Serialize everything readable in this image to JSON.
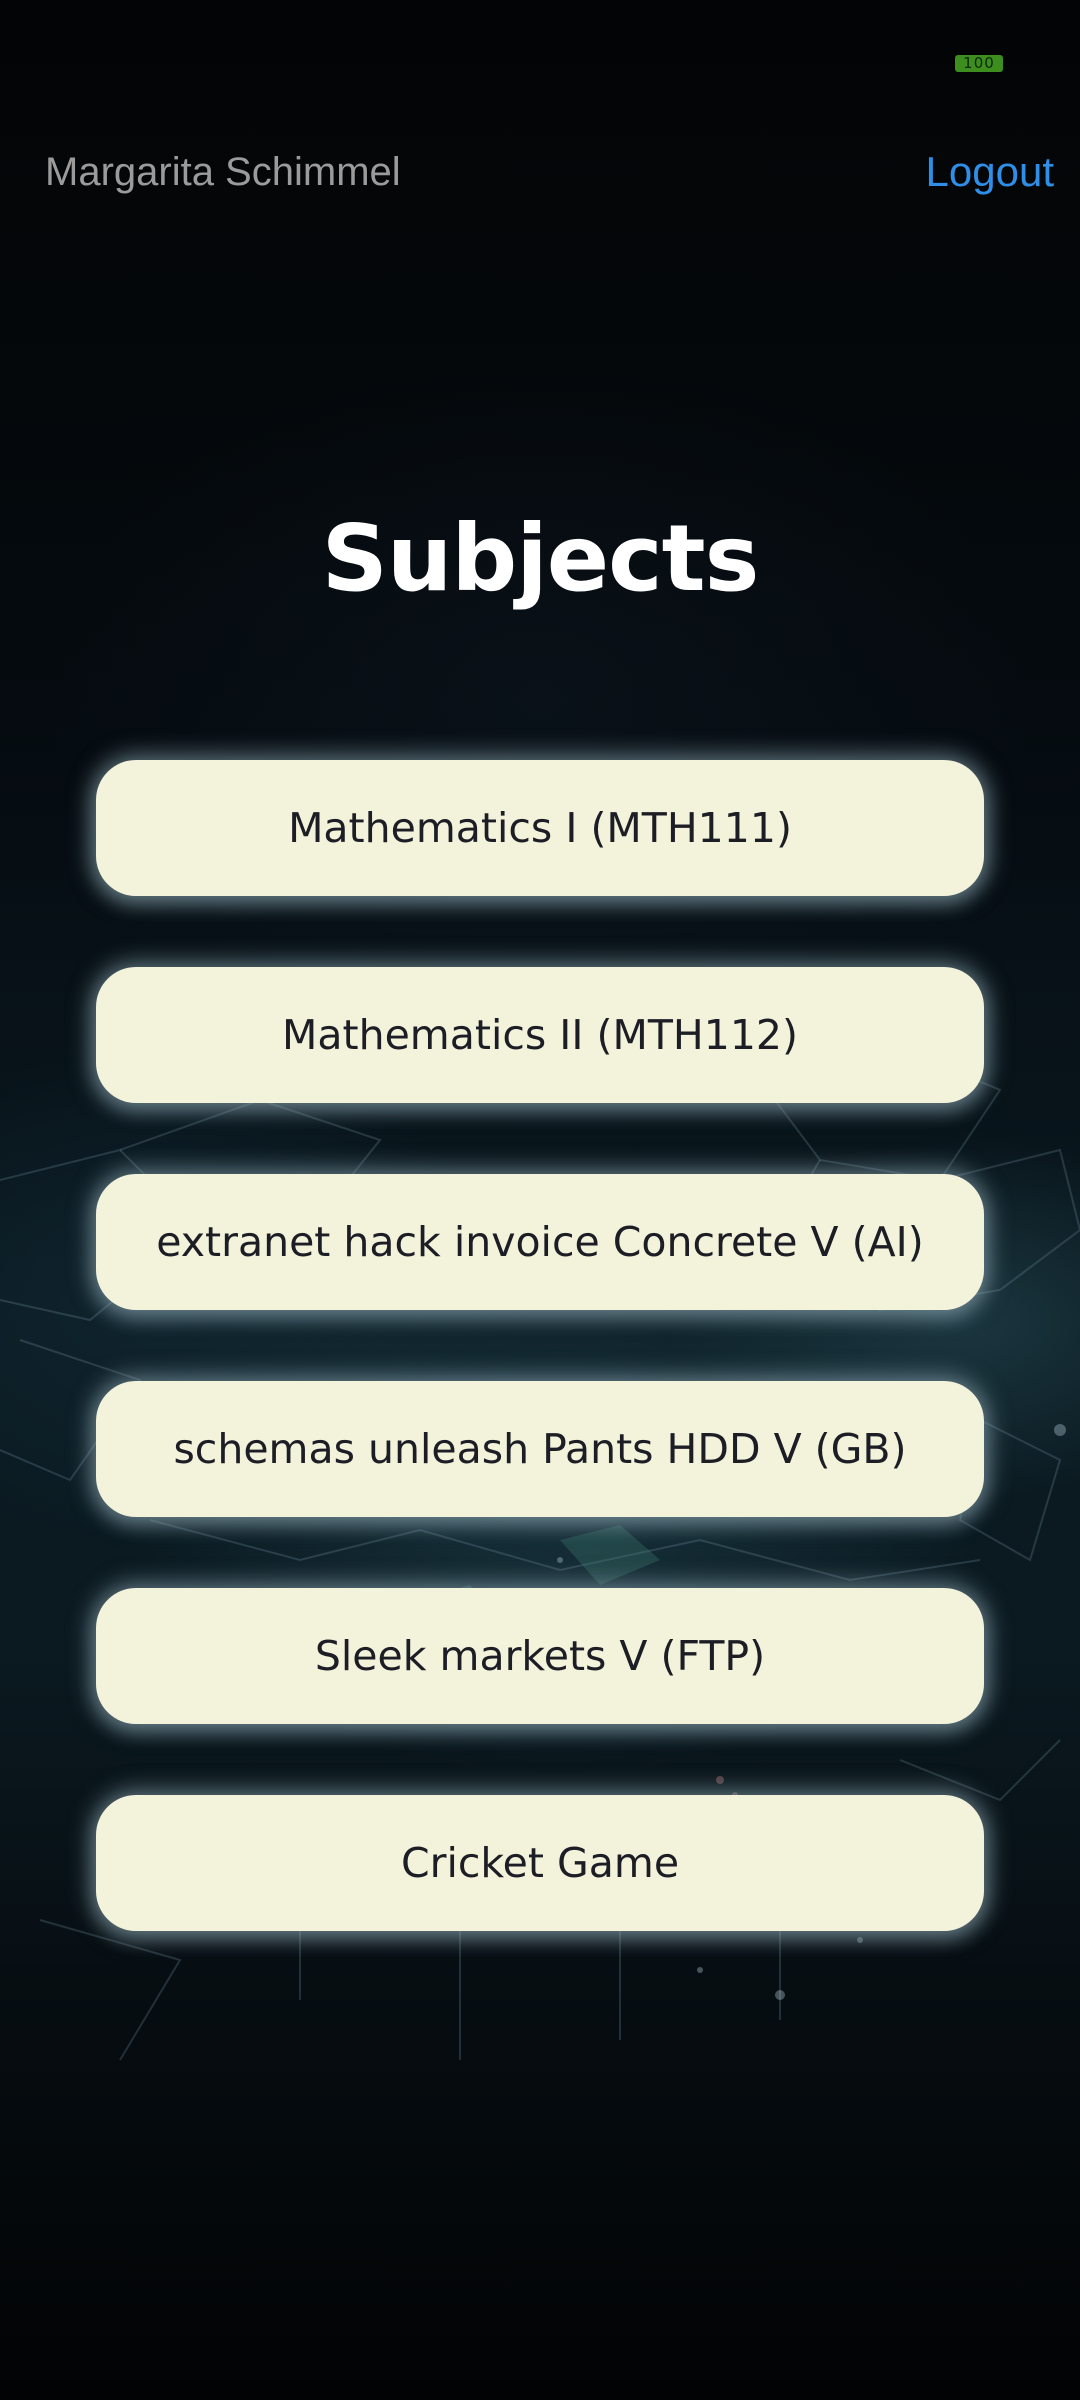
{
  "status_bar": {
    "battery_label": "100"
  },
  "header": {
    "user_name": "Margarita Schimmel",
    "logout_label": "Logout"
  },
  "main": {
    "title": "Subjects",
    "subjects": [
      {
        "label": "Mathematics I (MTH111)"
      },
      {
        "label": "Mathematics II (MTH112)"
      },
      {
        "label": "extranet hack invoice Concrete V (AI)"
      },
      {
        "label": "schemas unleash Pants HDD V (GB)"
      },
      {
        "label": "Sleek markets V (FTP)"
      },
      {
        "label": "Cricket Game"
      }
    ]
  },
  "colors": {
    "button_background": "#f3f3dc",
    "logout_link": "#2f8fe8",
    "battery": "#3e8e1f"
  }
}
